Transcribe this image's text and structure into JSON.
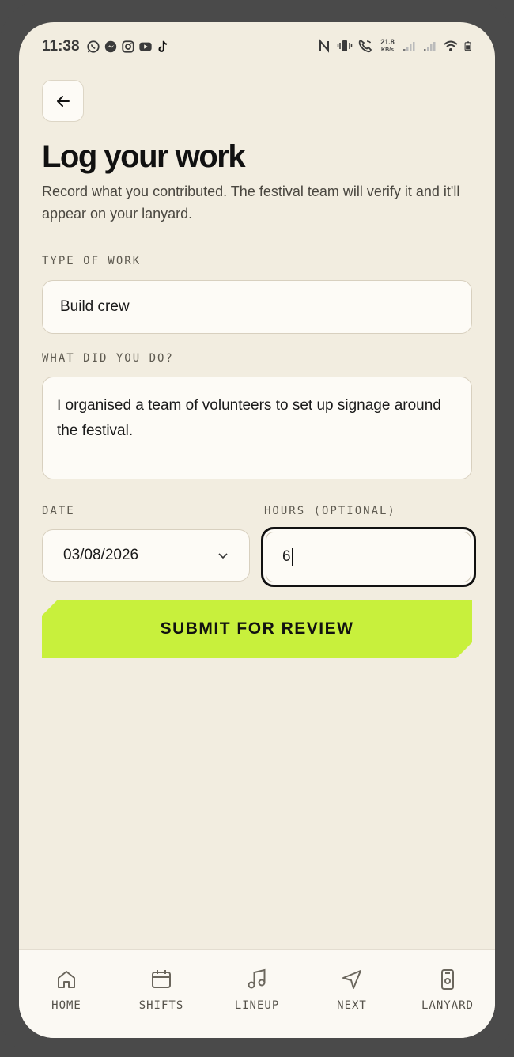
{
  "status_bar": {
    "time": "11:38",
    "network_speed_value": "21.8",
    "network_speed_unit": "KB/s"
  },
  "header": {
    "title": "Log your work",
    "subtitle": "Record what you contributed. The festival team will verify it and it'll appear on your lanyard."
  },
  "form": {
    "type_label": "TYPE OF WORK",
    "type_value": "Build crew",
    "description_label": "WHAT DID YOU DO?",
    "description_value": "I organised a team of volunteers to set up signage around the festival.",
    "date_label": "DATE",
    "date_value": "03/08/2026",
    "hours_label": "HOURS (OPTIONAL)",
    "hours_value": "6",
    "submit_label": "SUBMIT FOR REVIEW"
  },
  "colors": {
    "accent": "#c8f03c",
    "background": "#f2ede0",
    "surface": "#fdfbf6",
    "text": "#111111"
  },
  "nav": {
    "items": [
      {
        "label": "HOME",
        "icon": "home-icon"
      },
      {
        "label": "SHIFTS",
        "icon": "calendar-icon"
      },
      {
        "label": "LINEUP",
        "icon": "music-note-icon"
      },
      {
        "label": "NEXT",
        "icon": "navigation-arrow-icon"
      },
      {
        "label": "LANYARD",
        "icon": "badge-icon"
      }
    ]
  }
}
